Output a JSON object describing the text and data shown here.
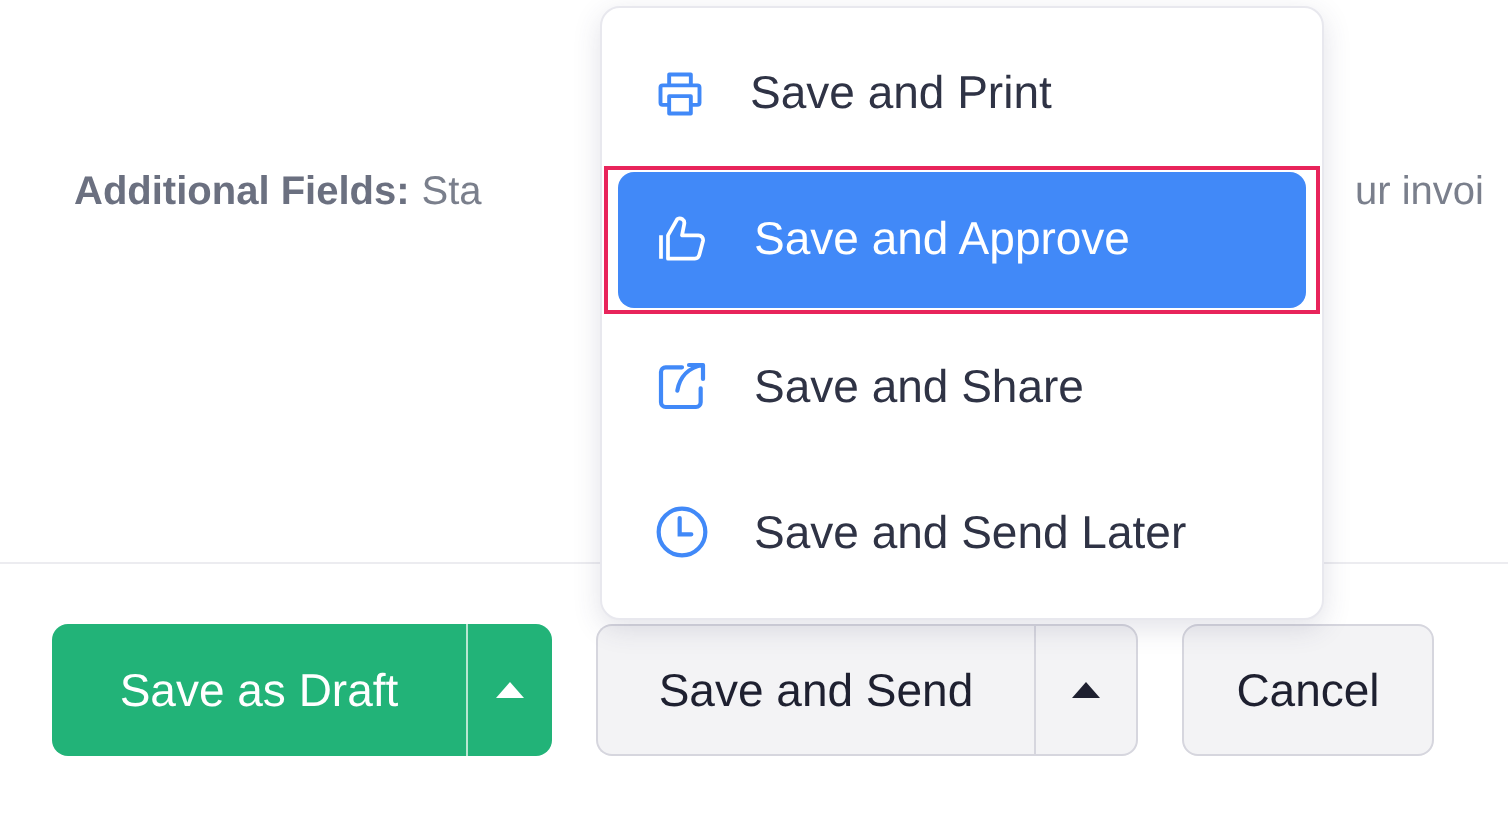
{
  "note": {
    "label": "Additional Fields:",
    "text_start": "Sta",
    "text_end": "ur invoi"
  },
  "menu": {
    "items": [
      {
        "label": "Save and Print",
        "kind": "print",
        "selected": false,
        "outlined": false
      },
      {
        "label": "Save and Approve",
        "kind": "approve",
        "selected": true,
        "outlined": true
      },
      {
        "label": "Save and Share",
        "kind": "share",
        "selected": false,
        "outlined": false
      },
      {
        "label": "Save and Send Later",
        "kind": "clock",
        "selected": false,
        "outlined": false
      }
    ]
  },
  "footer": {
    "draft": {
      "label": "Save as Draft"
    },
    "send": {
      "label": "Save and Send"
    },
    "cancel": {
      "label": "Cancel"
    }
  }
}
